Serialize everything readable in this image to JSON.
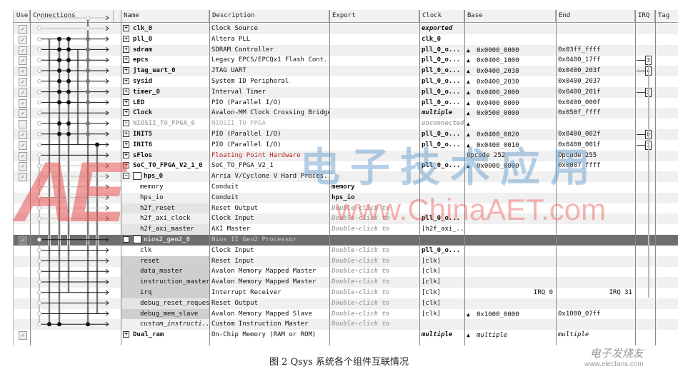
{
  "columns": {
    "use": "Use",
    "connections": "Connections",
    "name": "Name",
    "description": "Description",
    "export": "Export",
    "clock": "Clock",
    "base": "Base",
    "end": "End",
    "irq": "IRQ",
    "tags": "Tag"
  },
  "rows": [
    {
      "use": true,
      "type": "component",
      "name": "clk_0",
      "description": "Clock Source",
      "export": "",
      "clock": "exported",
      "clock_style": "italic-bold",
      "base": "",
      "end": "",
      "lock": false
    },
    {
      "use": true,
      "type": "component",
      "name": "pll_0",
      "description": "Altera PLL",
      "export": "",
      "clock": "clk_0",
      "base": "",
      "end": "",
      "lock": false
    },
    {
      "use": true,
      "type": "component",
      "name": "sdram",
      "description": "SDRAM Controller",
      "export": "",
      "clock": "pll_0_o...",
      "base": "0x0000_0000",
      "end": "0x03ff_ffff",
      "lock": true
    },
    {
      "use": true,
      "type": "component",
      "name": "epcs",
      "description": "Legacy EPCS/EPCQx1 Flash Cont...",
      "export": "",
      "clock": "pll_0_o...",
      "base": "0x0400_1000",
      "end": "0x0400_17ff",
      "lock": true,
      "irq": "3"
    },
    {
      "use": true,
      "type": "component",
      "name": "jtag_uart_0",
      "description": "JTAG UART",
      "export": "",
      "clock": "pll_0_o...",
      "base": "0x0400_2038",
      "end": "0x0400_203f",
      "lock": true,
      "irq": "4"
    },
    {
      "use": true,
      "type": "component",
      "name": "sysid",
      "description": "System ID Peripheral",
      "export": "",
      "clock": "pll_0_o...",
      "base": "0x0400_2030",
      "end": "0x0400_2037",
      "lock": true
    },
    {
      "use": true,
      "type": "component",
      "name": "timer_0",
      "description": "Interval Timer",
      "export": "",
      "clock": "pll_0_o...",
      "base": "0x0400_2000",
      "end": "0x0400_201f",
      "lock": true,
      "irq": "2"
    },
    {
      "use": true,
      "type": "component",
      "name": "LED",
      "description": "PIO (Parallel I/O)",
      "export": "",
      "clock": "pll_0_o...",
      "base": "0x0400_0000",
      "end": "0x0400_000f",
      "lock": true
    },
    {
      "use": true,
      "type": "component",
      "name": "Clock",
      "description": "Avalon-MM Clock Crossing Bridge",
      "export": "",
      "clock": "multiple",
      "clock_style": "italic-bold",
      "base": "0x0500_0000",
      "end": "0x050f_ffff",
      "lock": true
    },
    {
      "use": false,
      "type": "component-disabled",
      "name": "NIOSII_TO_FPGA_0",
      "description": "NIOSII_TO_FPGA",
      "export": "",
      "clock": "unconnected",
      "clock_style": "italic-dim",
      "base": "",
      "end": "",
      "lock": true
    },
    {
      "use": true,
      "type": "component",
      "name": "INIT5",
      "description": "PIO (Parallel I/O)",
      "export": "",
      "clock": "pll_0_o...",
      "base": "0x0400_0020",
      "end": "0x0400_002f",
      "lock": true,
      "irq": "0"
    },
    {
      "use": true,
      "type": "component",
      "name": "INIT6",
      "description": "PIO (Parallel I/O)",
      "export": "",
      "clock": "pll_0_o...",
      "base": "0x0400_0010",
      "end": "0x0400_001f",
      "lock": true,
      "irq": "1"
    },
    {
      "use": true,
      "type": "component-red",
      "name": "sFlos",
      "description": "Floating Point Hardware",
      "export": "",
      "clock": "",
      "base": "Opcode 252",
      "end": "Opcode 255",
      "lock": false
    },
    {
      "use": true,
      "type": "component",
      "name": "SoC_TO_FPGA_V2_1_0",
      "description": "SoC_TO_FPGA_V2_1",
      "export": "",
      "clock": "pll_0_o...",
      "base": "0x0000_0000",
      "end": "0x0007_ffff",
      "lock": true,
      "warn": true
    },
    {
      "use": true,
      "type": "parent",
      "name": "hps_0",
      "description": "Arria V/Cyclone V Hard Proces...",
      "export": "",
      "clock": "",
      "base": "",
      "end": ""
    },
    {
      "type": "port",
      "name": "memory",
      "description": "Conduit",
      "export": "memory",
      "clock": "",
      "base": "",
      "end": ""
    },
    {
      "type": "port",
      "name": "hps_io",
      "description": "Conduit",
      "export": "hps_io",
      "clock": "",
      "base": "",
      "end": ""
    },
    {
      "type": "port",
      "name": "h2f_reset",
      "description": "Reset Output",
      "export": "Double-click to",
      "clock": "",
      "base": "",
      "end": "",
      "shade": "light"
    },
    {
      "type": "port",
      "name": "h2f_axi_clock",
      "description": "Clock Input",
      "export": "Double-click to",
      "clock": "pll_0_o...",
      "base": "",
      "end": ""
    },
    {
      "type": "port",
      "name": "h2f_axi_master",
      "description": "AXI Master",
      "export": "Double-click to",
      "clock": "[h2f_axi_...",
      "base": "",
      "end": "",
      "shade": "light"
    },
    {
      "use": true,
      "type": "parent-selected",
      "name": "nios2_gen2_0",
      "description": "Nios II Gen2 Processor",
      "export": "",
      "clock": "",
      "base": "",
      "end": ""
    },
    {
      "type": "port",
      "name": "clk",
      "description": "Clock Input",
      "export": "Double-click to",
      "clock": "pll_0_o...",
      "base": "",
      "end": ""
    },
    {
      "type": "port",
      "name": "reset",
      "description": "Reset Input",
      "export": "Double-click to",
      "clock": "[clk]",
      "base": "",
      "end": "",
      "shade": "dark"
    },
    {
      "type": "port",
      "name": "data_master",
      "description": "Avalon Memory Mapped Master",
      "export": "Double-click to",
      "clock": "[clk]",
      "base": "",
      "end": "",
      "shade": "dark"
    },
    {
      "type": "port",
      "name": "instruction_master",
      "description": "Avalon Memory Mapped Master",
      "export": "Double-click to",
      "clock": "[clk]",
      "base": "",
      "end": "",
      "shade": "dark"
    },
    {
      "type": "port",
      "name": "irq",
      "description": "Interrupt Receiver",
      "export": "Double-click to",
      "clock": "[clk]",
      "base": "IRQ 0",
      "end": "IRQ 31",
      "shade": "dark",
      "irq_range": true
    },
    {
      "type": "port",
      "name": "debug_reset_request",
      "description": "Reset Output",
      "export": "Double-click to",
      "clock": "[clk]",
      "base": "",
      "end": "",
      "shade": "light"
    },
    {
      "type": "port",
      "name": "debug_mem_slave",
      "description": "Avalon Memory Mapped Slave",
      "export": "Double-click to",
      "clock": "[clk]",
      "base": "0x1000_0000",
      "end": "0x1000_07ff",
      "lock": true,
      "shade": "dark"
    },
    {
      "type": "port-italic",
      "name": "custom_instructi...",
      "description": "Custom Instruction Master",
      "export": "Double-click to",
      "clock": "",
      "base": "",
      "end": ""
    },
    {
      "use": true,
      "type": "component",
      "name": "Dual_ram",
      "description": "On-Chip Memory (RAM or ROM)",
      "export": "",
      "clock": "multiple",
      "clock_style": "italic-bold",
      "base": "multiple",
      "base_style": "italic",
      "end": "multiple",
      "end_style": "italic",
      "lock": true
    }
  ],
  "caption": "图 2  Qsys 系统各个组件互联情况",
  "watermarks": {
    "logo": "AE",
    "site_cn": "电子技术应用",
    "url": "www.ChinaAET.com",
    "elecfans_cn": "电子发烧友",
    "elecfans_url": "www.elecfans.com"
  }
}
